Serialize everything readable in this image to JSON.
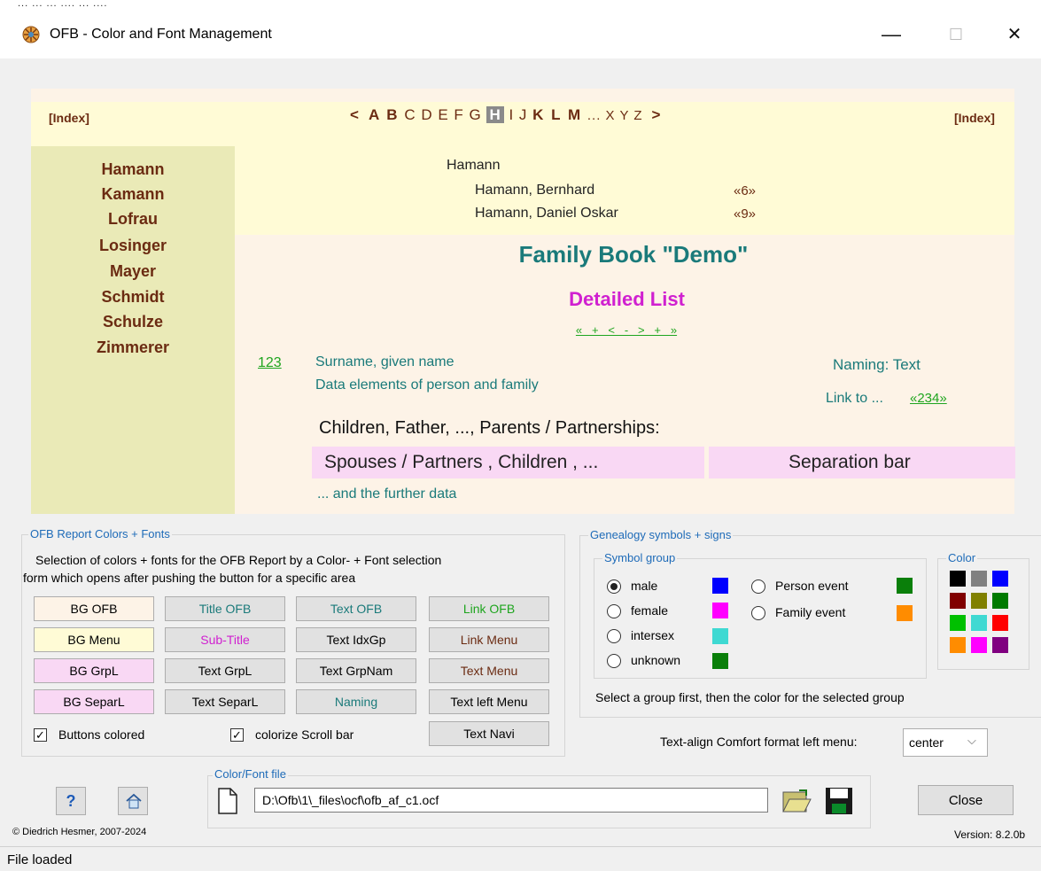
{
  "window": {
    "top_strip": "... ... ... .... ... ....",
    "title": "OFB - Color and Font Management",
    "minimize": "—",
    "maximize": "☐",
    "close": "✕"
  },
  "preview": {
    "index_left": "[Index]",
    "index_right": "[Index]",
    "nav_prev": "<",
    "letters_bold1": "A B",
    "letters_normal1": "C D E F G",
    "letter_current": "H",
    "letters_normal2": "I J",
    "letters_bold2": "K L M",
    "letters_normal3": "... X Y Z",
    "nav_next": ">",
    "left_menu": [
      "Hamann",
      "Kamann",
      "Lofrau",
      "Losinger",
      "Mayer",
      "Schmidt",
      "Schulze",
      "Zimmerer"
    ],
    "group_name": "Hamann",
    "group_entries": [
      {
        "name": "Hamann, Bernhard",
        "ref": "«6»"
      },
      {
        "name": "Hamann, Daniel Oskar",
        "ref": "«9»"
      }
    ],
    "family_title": "Family Book \"Demo\"",
    "sub_title": "Detailed List",
    "navi": "«   +   <   -   >   +   »",
    "id_link": "123",
    "surname_line": "Surname, given name",
    "data_line": "Data elements of person and family",
    "naming": "Naming: Text",
    "link_to": "Link to ...",
    "link_ref": "«234»",
    "children_head": "Children, Father, ..., Parents / Partnerships:",
    "spouses": "Spouses / Partners , Children , ...",
    "separation": "Separation bar",
    "further": "... and the further data"
  },
  "report_group": {
    "title": "OFB Report Colors + Fonts",
    "description_1": "Selection of colors + fonts for the OFB Report by a Color- + Font selection",
    "description_2": "form which opens after pushing the button for a specific area",
    "buttons": [
      [
        "BG OFB",
        "Title OFB",
        "Text OFB",
        "Link OFB"
      ],
      [
        "BG Menu",
        "Sub-Title",
        "Text IdxGp",
        "Link Menu"
      ],
      [
        "BG GrpL",
        "Text GrpL",
        "Text GrpNam",
        "Text Menu"
      ],
      [
        "BG SeparL",
        "Text SeparL",
        "Naming",
        "Text left Menu"
      ]
    ],
    "text_navi": "Text Navi",
    "buttons_colored": "Buttons colored",
    "colorize_scroll": "colorize Scroll bar"
  },
  "genealogy_group": {
    "title": "Genealogy symbols + signs",
    "symbol_group_title": "Symbol group",
    "symbols": [
      {
        "label": "male",
        "color": "#0000ff",
        "selected": true
      },
      {
        "label": "female",
        "color": "#ff00ff",
        "selected": false
      },
      {
        "label": "intersex",
        "color": "#3fd9d2",
        "selected": false
      },
      {
        "label": "unknown",
        "color": "#0a7f0a",
        "selected": false
      }
    ],
    "events": [
      {
        "label": "Person event",
        "color": "#0a7f0a"
      },
      {
        "label": "Family event",
        "color": "#ff8c00"
      }
    ],
    "color_title": "Color",
    "palette": [
      "#000000",
      "#808080",
      "#0000ff",
      "#800000",
      "#808000",
      "#007a00",
      "#00c000",
      "#3fd9d2",
      "#ff0000",
      "#ff8c00",
      "#ff00ff",
      "#800080"
    ],
    "hint": "Select a group first, then the color for the selected group"
  },
  "text_align": {
    "label": "Text-align Comfort format left menu:",
    "value": "center"
  },
  "file_group": {
    "title": "Color/Font file",
    "path": "D:\\Ofb\\1\\_files\\ocf\\ofb_af_c1.ocf"
  },
  "help": "?",
  "close_button": "Close",
  "copyright": "© Diedrich Hesmer, 2007-2024",
  "version": "Version: 8.2.0b",
  "status": "File loaded",
  "colors": {
    "bg_ofb": "#fdf3e7",
    "bg_menu": "#fffbd6",
    "bg_grpl": "#f9d8f4",
    "bg_separl": "#f9d8f4",
    "title": "#1a7a7a",
    "subtitle": "#d020d0",
    "link": "#1ea51e",
    "menu_text": "#6b2b12"
  }
}
